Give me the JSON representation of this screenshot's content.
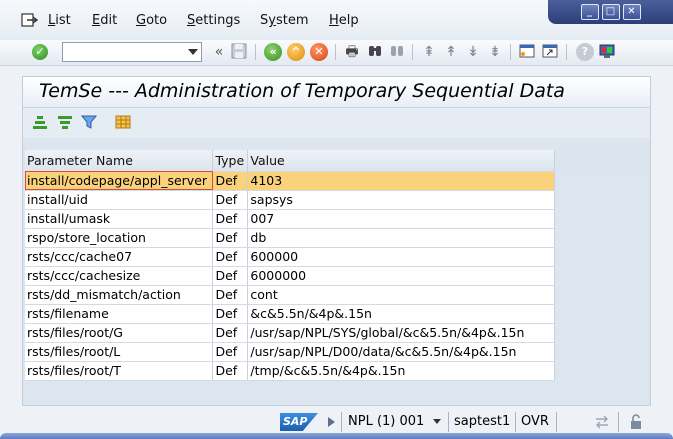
{
  "menu": {
    "items": [
      {
        "label": "List",
        "key": "L"
      },
      {
        "label": "Edit",
        "key": "E"
      },
      {
        "label": "Goto",
        "key": "G"
      },
      {
        "label": "Settings",
        "key": "S"
      },
      {
        "label": "System",
        "key": "y"
      },
      {
        "label": "Help",
        "key": "H"
      }
    ]
  },
  "window_controls": [
    "minimize",
    "maximize",
    "close"
  ],
  "toolbar": {
    "command_field_value": "",
    "icons": [
      "enter-icon",
      "save-icon",
      "back-icon",
      "exit-icon",
      "cancel-icon",
      "print-icon",
      "find-icon",
      "find-next-icon",
      "first-page-icon",
      "prev-page-icon",
      "next-page-icon",
      "last-page-icon",
      "new-session-icon",
      "shortcut-icon",
      "help-icon",
      "customize-layout-icon"
    ]
  },
  "screen": {
    "title": "TemSe --- Administration of Temporary Sequential Data"
  },
  "table": {
    "columns": [
      "Parameter Name",
      "Type",
      "Value"
    ],
    "rows": [
      {
        "name": "install/codepage/appl_server",
        "type": "Def",
        "value": "4103"
      },
      {
        "name": "install/uid",
        "type": "Def",
        "value": "sapsys"
      },
      {
        "name": "install/umask",
        "type": "Def",
        "value": "007"
      },
      {
        "name": "rspo/store_location",
        "type": "Def",
        "value": "db"
      },
      {
        "name": "rsts/ccc/cache07",
        "type": "Def",
        "value": "600000"
      },
      {
        "name": "rsts/ccc/cachesize",
        "type": "Def",
        "value": "6000000"
      },
      {
        "name": "rsts/dd_mismatch/action",
        "type": "Def",
        "value": "cont"
      },
      {
        "name": "rsts/filename",
        "type": "Def",
        "value": "&c&5.5n/&4p&.15n"
      },
      {
        "name": "rsts/files/root/G",
        "type": "Def",
        "value": "/usr/sap/NPL/SYS/global/&c&5.5n/&4p&.15n"
      },
      {
        "name": "rsts/files/root/L",
        "type": "Def",
        "value": "/usr/sap/NPL/D00/data/&c&5.5n/&4p&.15n"
      },
      {
        "name": "rsts/files/root/T",
        "type": "Def",
        "value": "/tmp/&c&5.5n/&4p&.15n"
      }
    ]
  },
  "status": {
    "logo": "SAP",
    "system": "NPL (1) 001",
    "host": "saptest1",
    "mode": "OVR"
  },
  "colors": {
    "selected_row": "#fbd27c",
    "selection_border": "#d94b3a",
    "window_controls": "#3d5096"
  }
}
